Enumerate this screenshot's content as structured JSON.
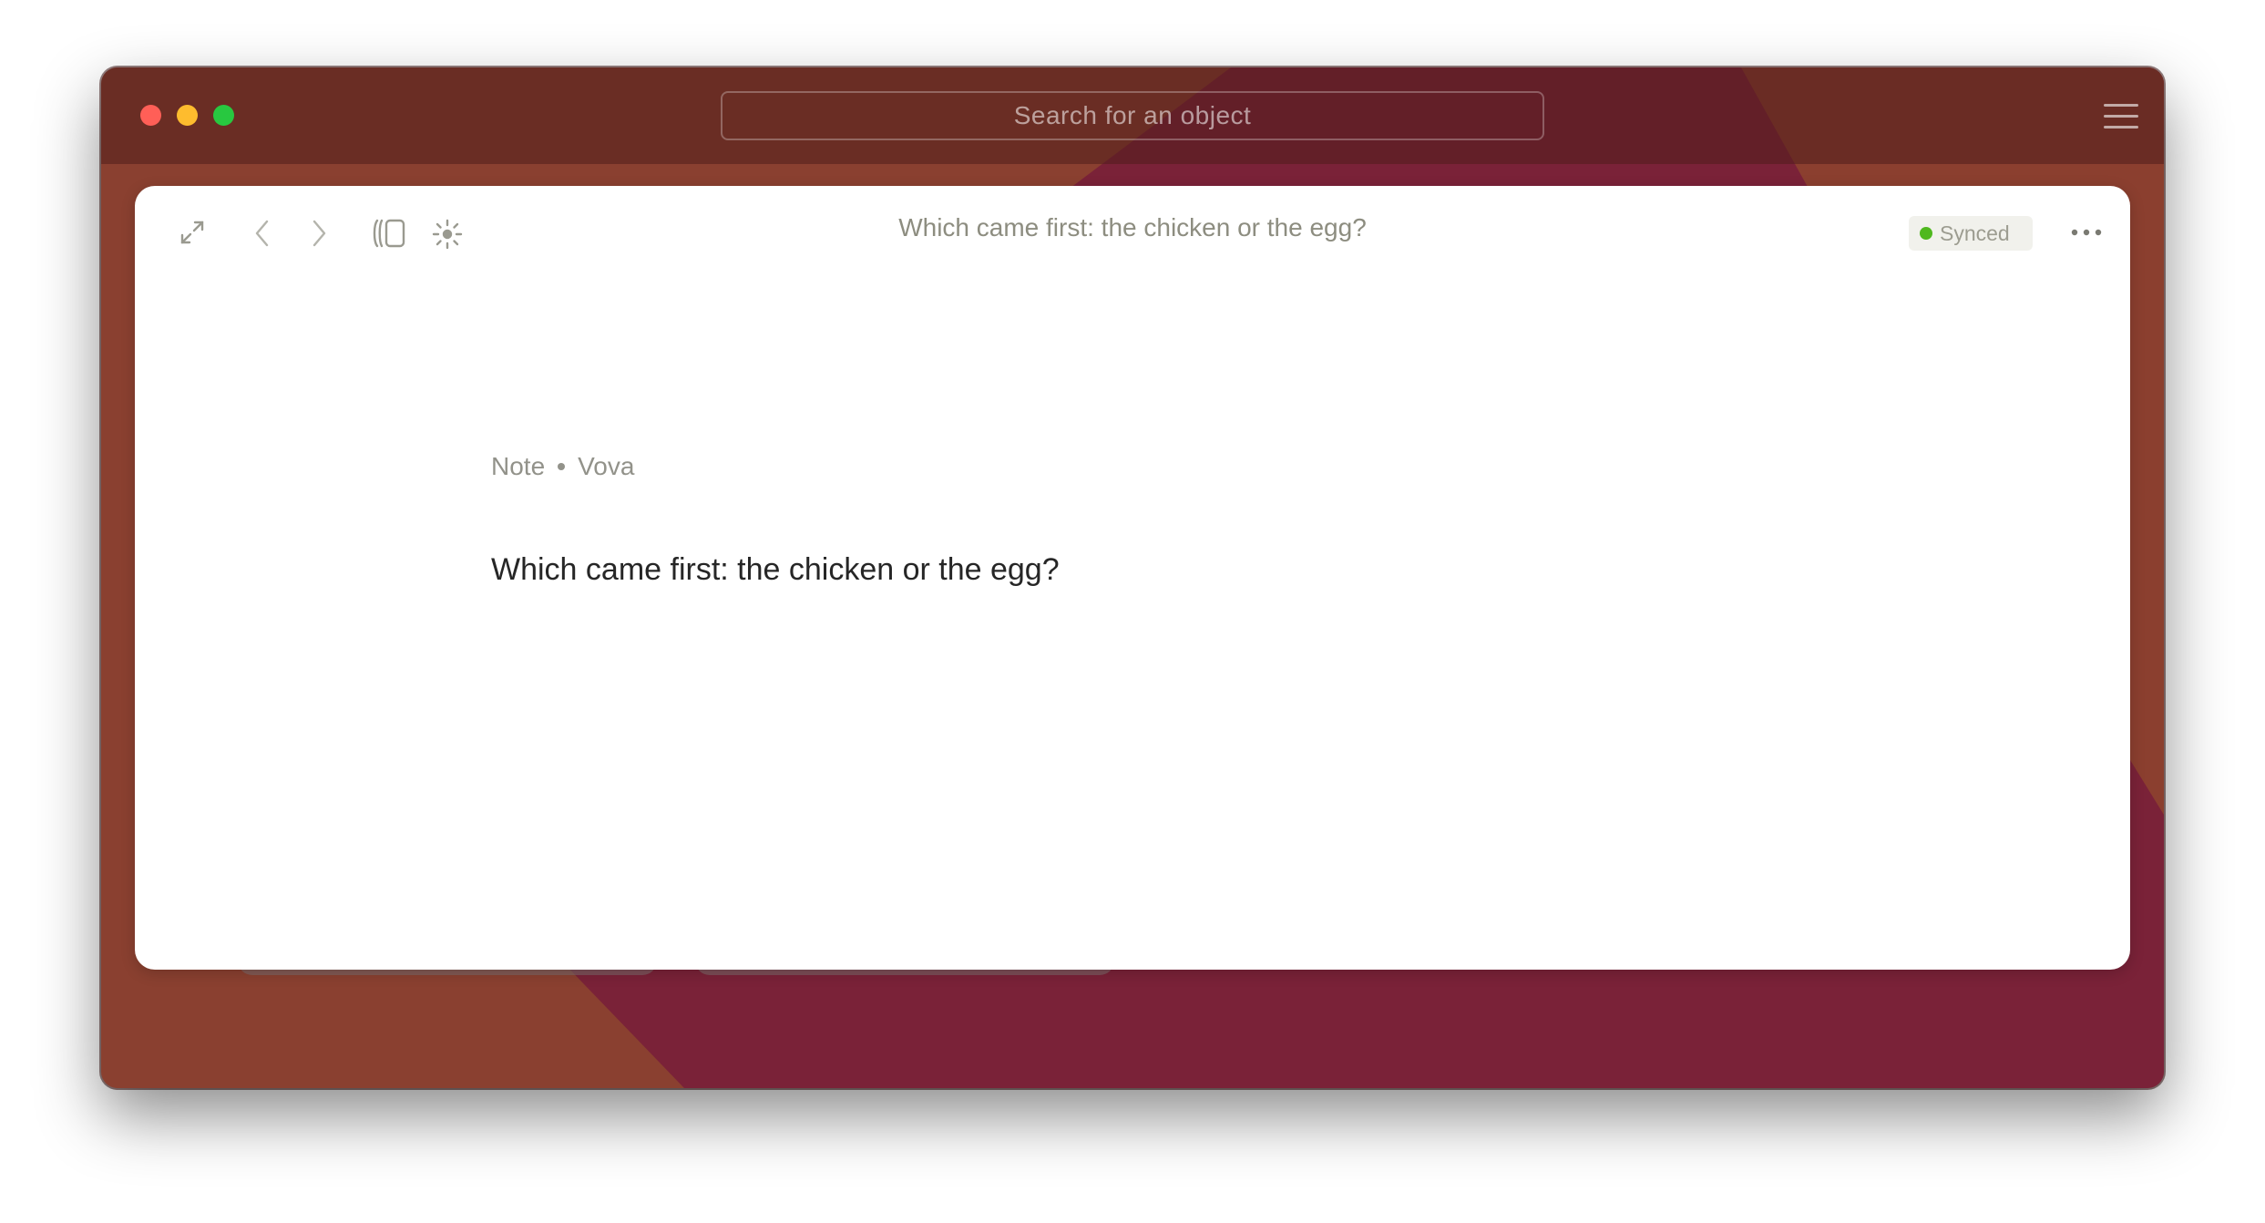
{
  "window": {
    "search_placeholder": "Search for an object"
  },
  "toolbar": {
    "title": "Which came first: the chicken or the egg?",
    "sync_status": "Synced",
    "sync_color": "#4fb81e"
  },
  "note": {
    "type": "Note",
    "author": "Vova",
    "text": "Which came first: the chicken or the egg?"
  },
  "icons": [
    "expand-icon",
    "back-arrow-icon",
    "forward-arrow-icon",
    "sidebar-icon",
    "graph-icon",
    "more-icon",
    "menu-icon"
  ],
  "colors": {
    "background_orange": "#8a4030",
    "background_crimson": "#7a2238",
    "traffic_red": "#ff5f57",
    "traffic_yellow": "#febc2e",
    "traffic_green": "#28c840"
  }
}
